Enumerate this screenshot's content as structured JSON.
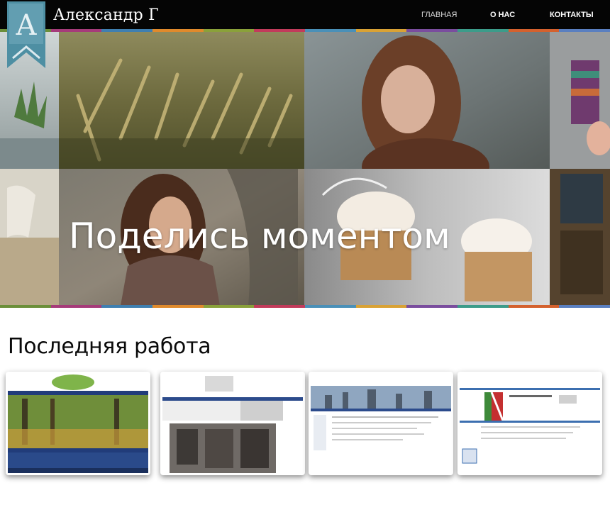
{
  "header": {
    "logo_letter": "А",
    "site_title": "Александр Г",
    "nav": [
      {
        "label": "ГЛАВНАЯ"
      },
      {
        "label": "О НАС"
      },
      {
        "label": "КОНТАКТЫ"
      }
    ]
  },
  "hero": {
    "headline": "Поделись моментом",
    "stripe_colors": [
      "#6b8f3a",
      "#a63b7a",
      "#3f7fb0",
      "#e08a2c",
      "#8aa13a",
      "#c23b5b",
      "#4a90b8",
      "#d9a235",
      "#7a4d9e",
      "#3c9c8a",
      "#d4612e",
      "#5a7fc0"
    ]
  },
  "works": {
    "title": "Последняя работа",
    "items": [
      {
        "name": "work-thumbnail-forest-site"
      },
      {
        "name": "work-thumbnail-windows-site"
      },
      {
        "name": "work-thumbnail-city-site"
      },
      {
        "name": "work-thumbnail-transport-site"
      }
    ]
  },
  "colors": {
    "header_bg": "#050505",
    "logo_bg": "#4e8fa3",
    "text_dark": "#0a0a0a"
  }
}
